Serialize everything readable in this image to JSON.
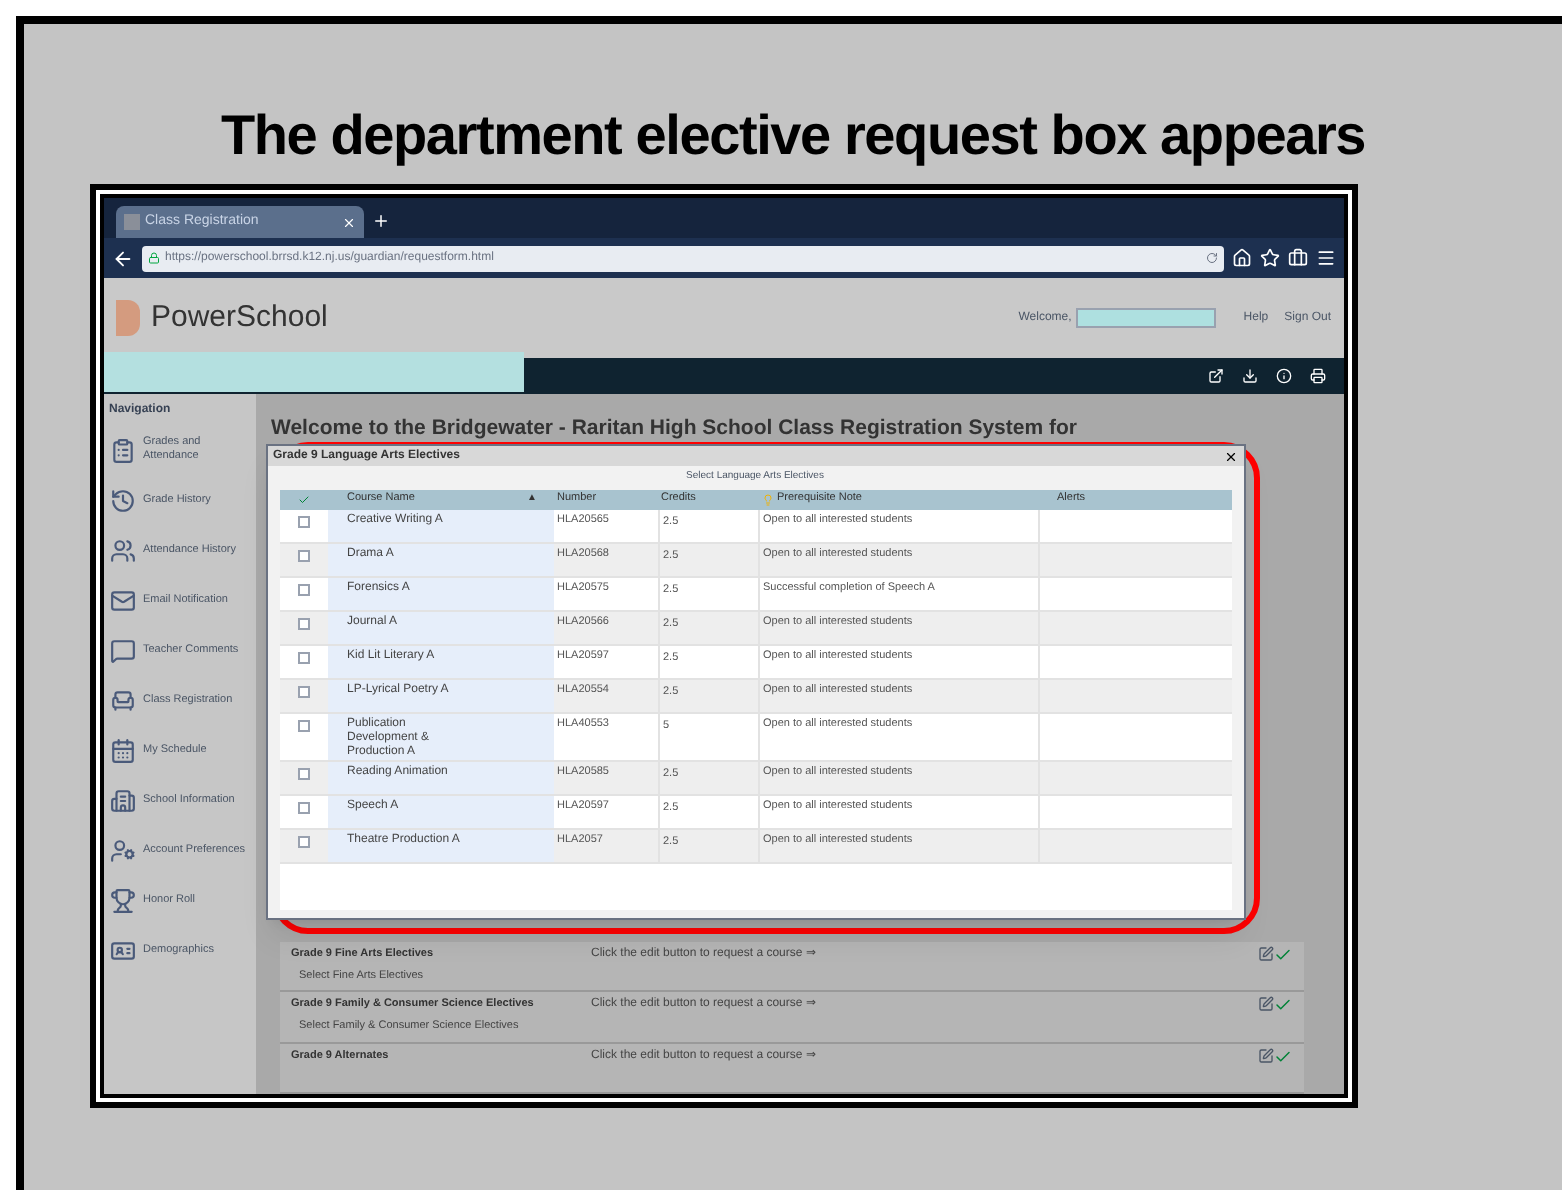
{
  "slide_title": "The department elective request box appears",
  "browser": {
    "tab_title": "Class Registration",
    "url": "https://powerschool.brrsd.k12.nj.us/guardian/requestform.html"
  },
  "header": {
    "logo_text": "PowerSchool",
    "welcome": "Welcome,",
    "links": [
      "Help",
      "Sign Out"
    ]
  },
  "navigation": {
    "title": "Navigation",
    "items": [
      {
        "label": "Grades and Attendance"
      },
      {
        "label": "Grade History"
      },
      {
        "label": "Attendance History"
      },
      {
        "label": "Email Notification"
      },
      {
        "label": "Teacher Comments"
      },
      {
        "label": "Class Registration"
      },
      {
        "label": "My Schedule"
      },
      {
        "label": "School Information"
      },
      {
        "label": "Account Preferences"
      },
      {
        "label": "Honor Roll"
      },
      {
        "label": "Demographics"
      }
    ]
  },
  "page_heading": "Welcome to the Bridgewater - Raritan High School Class Registration System for",
  "sections": [
    {
      "title": "Grade 9 Fine Arts Electives",
      "subtitle": "Select Fine Arts Electives",
      "hint": "Click the edit button to request a course ⇒"
    },
    {
      "title": "Grade 9 Family & Consumer Science Electives",
      "subtitle": "Select Family & Consumer Science Electives",
      "hint": "Click the edit button to request a course ⇒"
    },
    {
      "title": "Grade 9 Alternates",
      "hint": "Click the edit button to request a course ⇒"
    }
  ],
  "dialog": {
    "title": "Grade 9 Language Arts Electives",
    "subtitle": "Select Language Arts Electives",
    "sort_arrow": "▲",
    "columns": [
      {
        "label": "Course Name",
        "sorted": true
      },
      {
        "label": "Number",
        "sorted": false
      },
      {
        "label": "Credits",
        "sorted": false
      },
      {
        "label": "Prerequisite Note",
        "sorted": false
      },
      {
        "label": "Alerts",
        "sorted": false
      }
    ],
    "rows": [
      {
        "checked": false,
        "name": "Creative Writing A",
        "number": "HLA20565",
        "credits": "2.5",
        "note": "Open to all interested students"
      },
      {
        "checked": false,
        "name": "Drama A",
        "number": "HLA20568",
        "credits": "2.5",
        "note": "Open to all interested students"
      },
      {
        "checked": false,
        "name": "Forensics A",
        "number": "HLA20575",
        "credits": "2.5",
        "note": "Successful completion of Speech A"
      },
      {
        "checked": false,
        "name": "Journal A",
        "number": "HLA20566",
        "credits": "2.5",
        "note": "Open to all interested students"
      },
      {
        "checked": false,
        "name": "Kid Lit Literary A",
        "number": "HLA20597",
        "credits": "2.5",
        "note": "Open to all interested students"
      },
      {
        "checked": false,
        "name": "LP-Lyrical Poetry A",
        "number": "HLA20554",
        "credits": "2.5",
        "note": "Open to all interested students"
      },
      {
        "checked": false,
        "name": "Publication Development & Production A",
        "number": "HLA40553",
        "credits": "5",
        "note": "Open to all interested students"
      },
      {
        "checked": false,
        "name": "Reading Animation",
        "number": "HLA20585",
        "credits": "2.5",
        "note": "Open to all interested students"
      },
      {
        "checked": false,
        "name": "Speech A",
        "number": "HLA20597",
        "credits": "2.5",
        "note": "Open to all interested students"
      },
      {
        "checked": false,
        "name": "Theatre Production A",
        "number": "HLA2057",
        "credits": "2.5",
        "note": "Open to all interested students"
      }
    ]
  }
}
